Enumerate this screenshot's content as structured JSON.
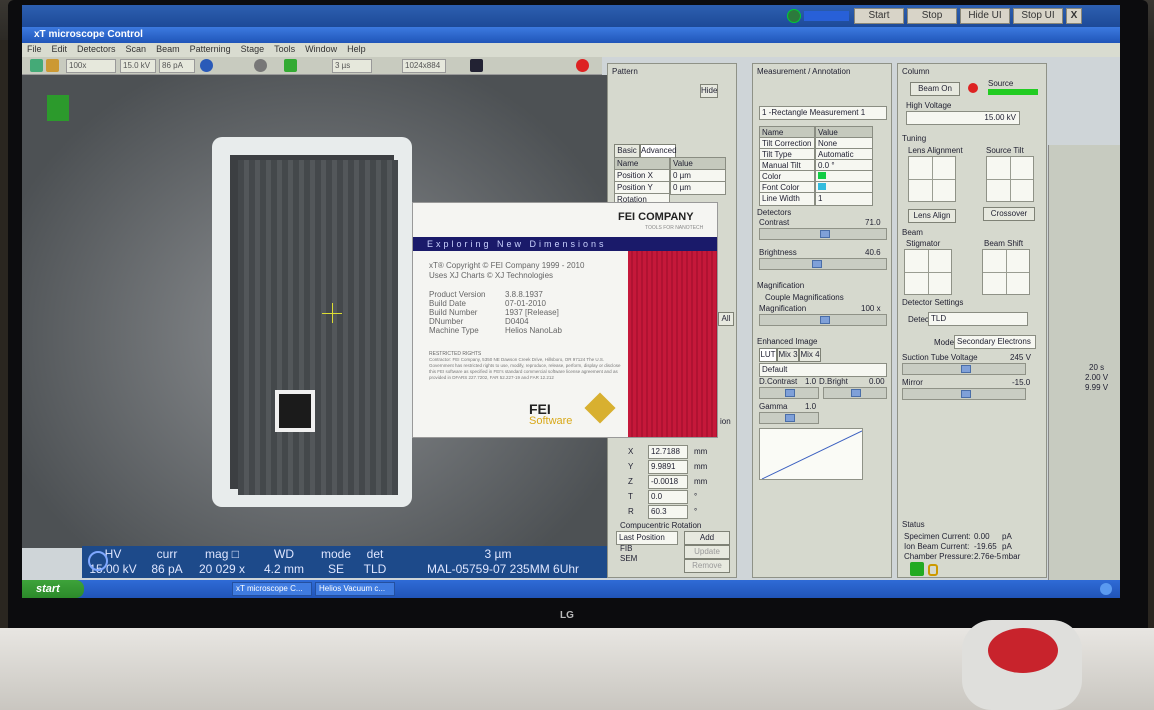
{
  "app_title": "xT microscope Control",
  "topbar": {
    "start": "Start",
    "stop": "Stop",
    "hide": "Hide UI",
    "stop_ui": "Stop UI",
    "close": "X"
  },
  "menu": [
    "File",
    "Edit",
    "Detectors",
    "Scan",
    "Beam",
    "Patterning",
    "Stage",
    "Tools",
    "Window",
    "Help"
  ],
  "toolbar": {
    "magnification": "100x",
    "hv": "15.0 kV",
    "current": "86 pA",
    "dwell": "3 µs",
    "resolution": "1024x884"
  },
  "pattern": {
    "title": "Pattern",
    "hide_label": "Hide",
    "tabs": [
      "Basic",
      "Advanced"
    ],
    "table_headers": [
      "Name",
      "Value"
    ],
    "rows": [
      [
        "Position X",
        "0 µm"
      ],
      [
        "Position Y",
        "0 µm"
      ],
      [
        "Rotation",
        ""
      ]
    ]
  },
  "stage": {
    "rows": [
      [
        "X",
        "12.7188",
        "mm"
      ],
      [
        "Y",
        "9.9891",
        "mm"
      ],
      [
        "Z",
        "-0.0018",
        "mm"
      ],
      [
        "T",
        "0.0",
        "°"
      ],
      [
        "R",
        "60.3",
        "°"
      ]
    ],
    "compucentric": "Compucentric Rotation",
    "last_position": "Last Position",
    "positions": [
      "FIB",
      "SEM"
    ],
    "add": "Add",
    "update": "Update",
    "remove": "Remove",
    "tion_fragment": "ion",
    "all_fragment": "All"
  },
  "measurement": {
    "title": "Measurement / Annotation",
    "selected": "1 -Rectangle Measurement 1",
    "headers": [
      "Name",
      "Value"
    ],
    "rows": [
      [
        "Tilt Correction",
        "None"
      ],
      [
        "Tilt Type",
        "Automatic"
      ],
      [
        "Manual Tilt",
        "0.0 °"
      ],
      [
        "Color",
        ""
      ],
      [
        "Font Color",
        ""
      ],
      [
        "Line Width",
        "1"
      ]
    ]
  },
  "detectors": {
    "title": "Detectors",
    "contrast_label": "Contrast",
    "contrast": "71.0",
    "brightness_label": "Brightness",
    "brightness": "40.6"
  },
  "magnification": {
    "title": "Magnification",
    "couple": "Couple Magnifications",
    "label": "Magnification",
    "value": "100 x"
  },
  "enhanced": {
    "title": "Enhanced Image",
    "tabs": [
      "LUT",
      "Mix 3",
      "Mix 4"
    ],
    "preset": "Default",
    "dcontrast_label": "D.Contrast",
    "dcontrast": "1.0",
    "dbright_label": "D.Bright",
    "dbright": "0.00",
    "gamma_label": "Gamma",
    "gamma": "1.0"
  },
  "column": {
    "title": "Column",
    "beam_on": "Beam On",
    "source": "Source",
    "hv_label": "High Voltage",
    "hv": "15.00 kV",
    "tuning": "Tuning",
    "lens_alignment": "Lens Alignment",
    "source_tilt": "Source Tilt",
    "lens_align_btn": "Lens Align",
    "crossover_btn": "Crossover",
    "beam": "Beam",
    "stigmator": "Stigmator",
    "beam_shift": "Beam Shift",
    "detector_settings": "Detector Settings",
    "detector_label": "Detector",
    "detector": "TLD",
    "mode_label": "Mode",
    "mode": "Secondary Electrons",
    "suction_label": "Suction Tube Voltage",
    "suction": "245 V",
    "mirror_label": "Mirror",
    "mirror": "-15.0"
  },
  "status": {
    "title": "Status",
    "specimen_label": "Specimen Current:",
    "specimen": "0.00",
    "specimen_unit": "pA",
    "ion_label": "Ion Beam Current:",
    "ion": "-19.65",
    "ion_unit": "pA",
    "chamber_label": "Chamber Pressure:",
    "chamber": "2.76e-5",
    "chamber_unit": "mbar"
  },
  "far_right": [
    "20 s",
    "2.00 V",
    "9.99 V"
  ],
  "infobar": {
    "labels": [
      "HV",
      "curr",
      "mag □",
      "WD",
      "mode",
      "det"
    ],
    "values": [
      "15.00 kV",
      "86 pA",
      "20 029 x",
      "4.2 mm",
      "SE",
      "TLD"
    ],
    "scale": "3 µm",
    "sample": "MAL-05759-07 235MM 6Uhr"
  },
  "splash": {
    "company": "FEI COMPANY",
    "tagline": "TOOLS FOR NANOTECH",
    "banner": "Exploring New Dimensions",
    "copy1": "xT® Copyright © FEI Company 1999 - 2010",
    "copy2": "Uses XJ Charts © XJ Technologies",
    "labels": [
      "Product Version",
      "Build Date",
      "Build Number",
      "DNumber",
      "Machine Type"
    ],
    "values": [
      "3.8.8.1937",
      "07-01-2010",
      "1937 [Release]",
      "D0404",
      "Helios NanoLab"
    ],
    "rights_title": "RESTRICTED RIGHTS",
    "rights": "Contractor: FEI Company, 5350 NE Dawson Creek Drive, Hillsboro, OR 97124 The U.S. Government has restricted rights to use, modify, reproduce, release, perform, display or disclose this FEI software as specified in FEI's standard commercial software license agreement and as provided in DFARS 227.7202, FAR 52.227-19 and FAR 12.212",
    "logo1": "FEI",
    "logo2": "Software"
  },
  "taskbar": {
    "start": "start",
    "tasks": [
      "xT microscope C...",
      "Helios Vacuum c..."
    ]
  },
  "monitor_brand": "LG"
}
